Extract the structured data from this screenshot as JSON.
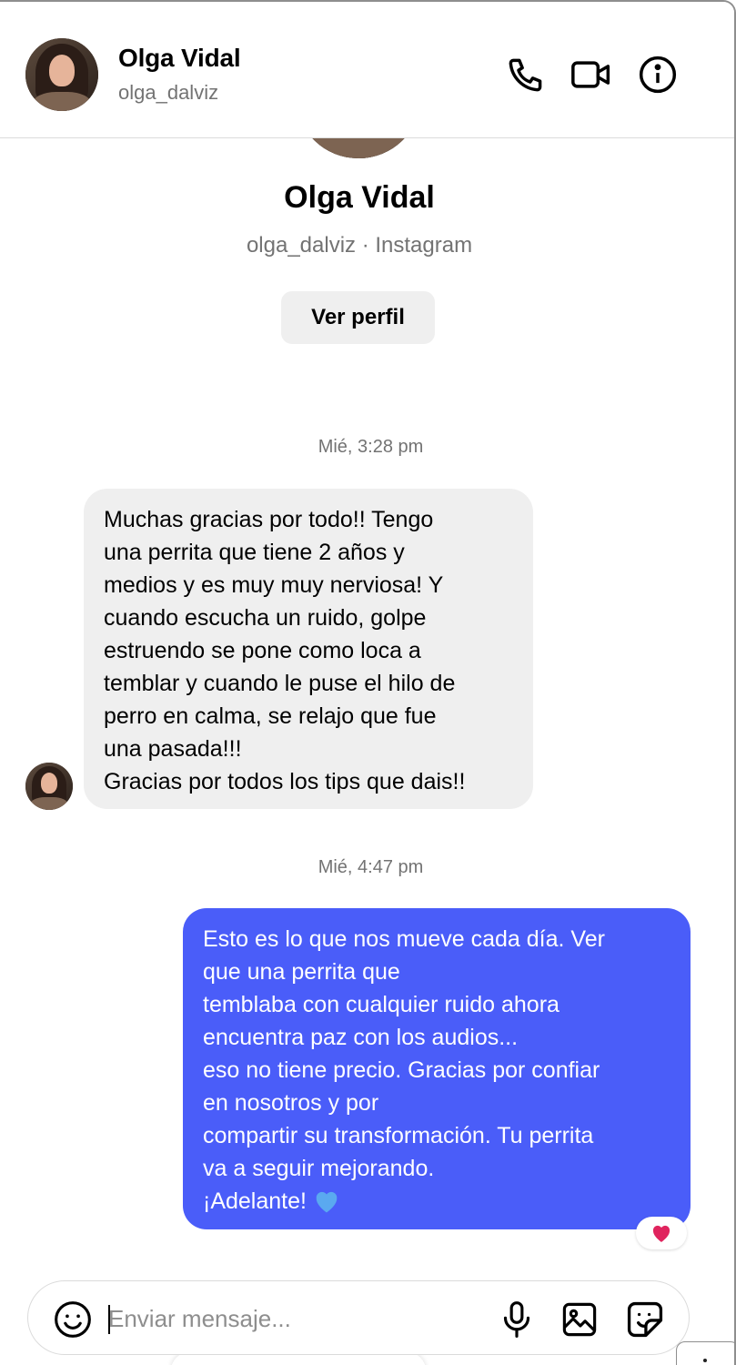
{
  "header": {
    "name": "Olga Vidal",
    "handle": "olga_dalviz",
    "icons": [
      "phone-icon",
      "video-icon",
      "info-icon"
    ]
  },
  "profile": {
    "name": "Olga Vidal",
    "subtitle": "olga_dalviz · Instagram",
    "view_profile_label": "Ver perfil"
  },
  "messages": [
    {
      "timestamp": "Mié, 3:28 pm",
      "direction": "incoming",
      "lines": [
        "Muchas gracias por todo!! Tengo",
        "una perrita que tiene 2 años y",
        "medios y es muy muy nerviosa! Y",
        "cuando escucha un ruido, golpe",
        "estruendo se pone como loca a",
        "temblar y cuando le puse el hilo de",
        "perro en calma, se relajo que fue",
        "una pasada!!!",
        "Gracias por todos los tips que dais!!"
      ]
    },
    {
      "timestamp": "Mié, 4:47 pm",
      "direction": "outgoing",
      "lines": [
        "Esto es lo que nos mueve cada día. Ver",
        "que una perrita que",
        "temblaba con cualquier ruido ahora",
        "encuentra paz con los audios...",
        "eso no tiene precio. Gracias por confiar",
        "en nosotros y por",
        "compartir su transformación. Tu perrita",
        "va a seguir mejorando.",
        "¡Adelante!"
      ],
      "reaction": "heart"
    }
  ],
  "composer": {
    "placeholder": "Enviar mensaje...",
    "icons": [
      "emoji-icon",
      "microphone-icon",
      "image-icon",
      "sticker-icon"
    ]
  },
  "colors": {
    "outgoing_bubble": "#4a5df9",
    "incoming_bubble": "#efefef",
    "secondary_text": "#737373",
    "reaction_heart": "#e0245e",
    "blue_heart": "#5aa9f0"
  }
}
